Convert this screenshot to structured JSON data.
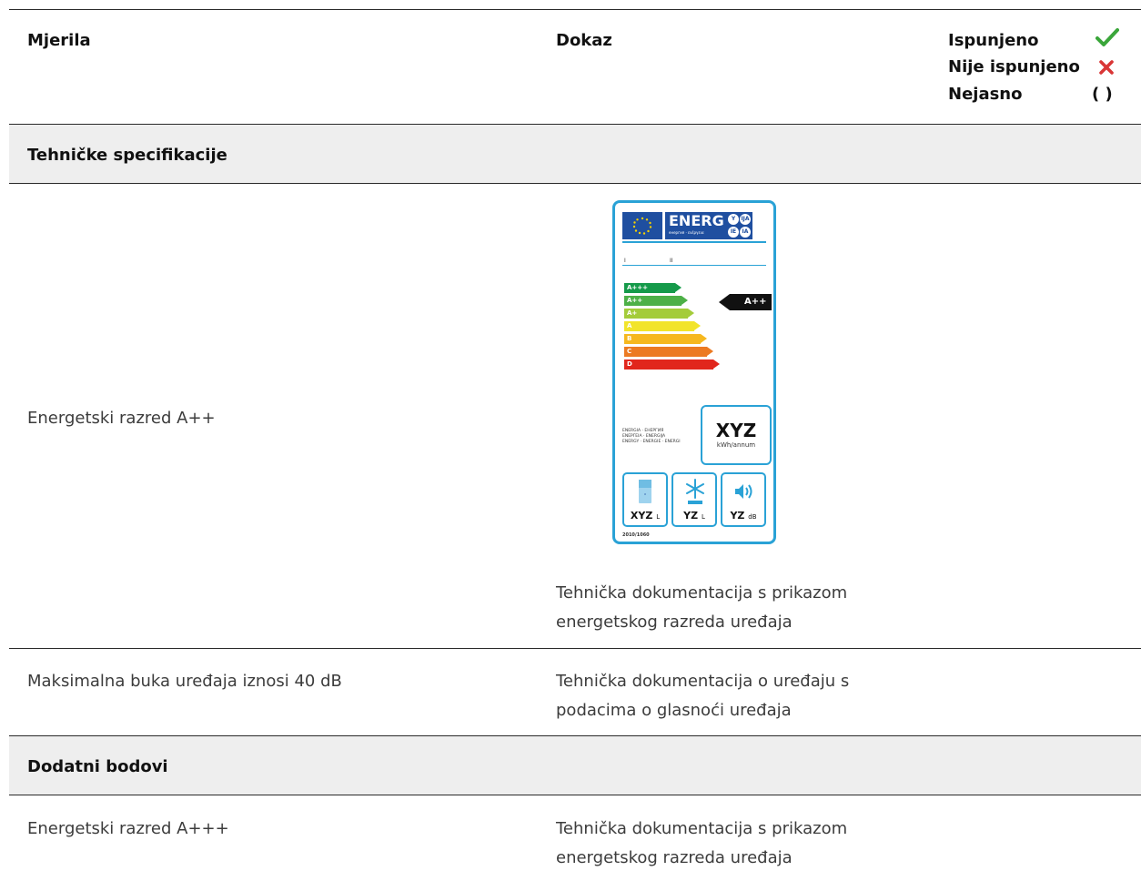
{
  "header": {
    "col_criteria": "Mjerila",
    "col_evidence": "Dokaz",
    "legend": {
      "met": "Ispunjeno",
      "not_met": "Nije ispunjeno",
      "unclear": "Nejasno",
      "unclear_symbol": "( )",
      "met_color": "#3aa63a",
      "not_met_color": "#d93636"
    }
  },
  "sections": [
    {
      "title": "Tehničke specifikacije",
      "rows": [
        {
          "criterion": "Energetski razred A++",
          "evidence_line1": "Tehnička dokumentacija s prikazom",
          "evidence_line2": "energetskog razreda uređaja"
        },
        {
          "criterion": "Maksimalna buka uređaja iznosi 40 dB",
          "evidence_line1": "Tehnička dokumentacija o uređaju s",
          "evidence_line2": "podacima o glasnoći uređaja"
        }
      ]
    },
    {
      "title": "Dodatni bodovi",
      "rows": [
        {
          "criterion": "Energetski razred A+++",
          "evidence_line1": "Tehnička dokumentacija s prikazom",
          "evidence_line2": "energetskog razreda uređaja"
        }
      ]
    }
  ],
  "energy_label": {
    "brand": "ENERG",
    "brand_sub": "енергия · ενέργεια",
    "lang": [
      "Y",
      "IJA",
      "IE",
      "IA"
    ],
    "roman_1": "I",
    "roman_2": "II",
    "classes": [
      "A+++",
      "A++",
      "A+",
      "A",
      "B",
      "C",
      "D"
    ],
    "class_colors": [
      "#159a4a",
      "#4db047",
      "#a4cc3a",
      "#f2e42a",
      "#f6b81f",
      "#ec7a22",
      "#e1261c"
    ],
    "indicator": "A++",
    "energy_value": "XYZ",
    "energy_unit": "kWh/annum",
    "words_line1": "ENERGIA · ЕНЕРГИЯ",
    "words_line2": "ΕΝΕΡΓΕΙΑ · ENERGIJA",
    "words_line3": "ENERGY · ENERGIE · ENERGI",
    "fridge_value": "XYZ",
    "fridge_unit": "L",
    "freezer_value": "YZ",
    "freezer_unit": "L",
    "noise_value": "YZ",
    "noise_unit": "dB",
    "regulation": "2010/1060"
  }
}
